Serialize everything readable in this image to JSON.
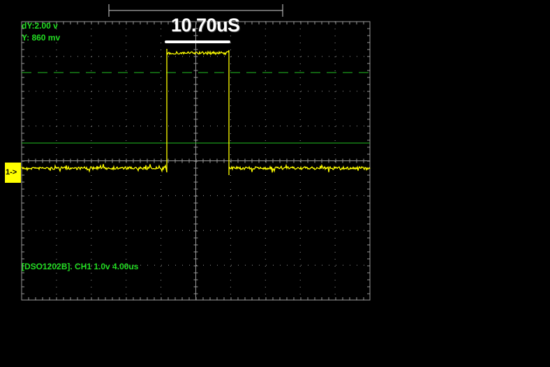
{
  "readouts": {
    "dy": "dY:2.00 v",
    "y": "Y:  860 mv"
  },
  "measurement": {
    "value": "10.70uS"
  },
  "status": {
    "line": "[DSO1202B]. CH1 1.0v 4.00us"
  },
  "channel_marker": {
    "label": "1->"
  },
  "colors": {
    "background": "#000000",
    "grid": "#9a9a9a",
    "trace": "#ffff00",
    "cursor": "#22c022",
    "readout_text": "#22dd22",
    "measure_text": "#ffffff"
  },
  "icons": {
    "channel_marker": "channel-1-marker-icon"
  }
}
